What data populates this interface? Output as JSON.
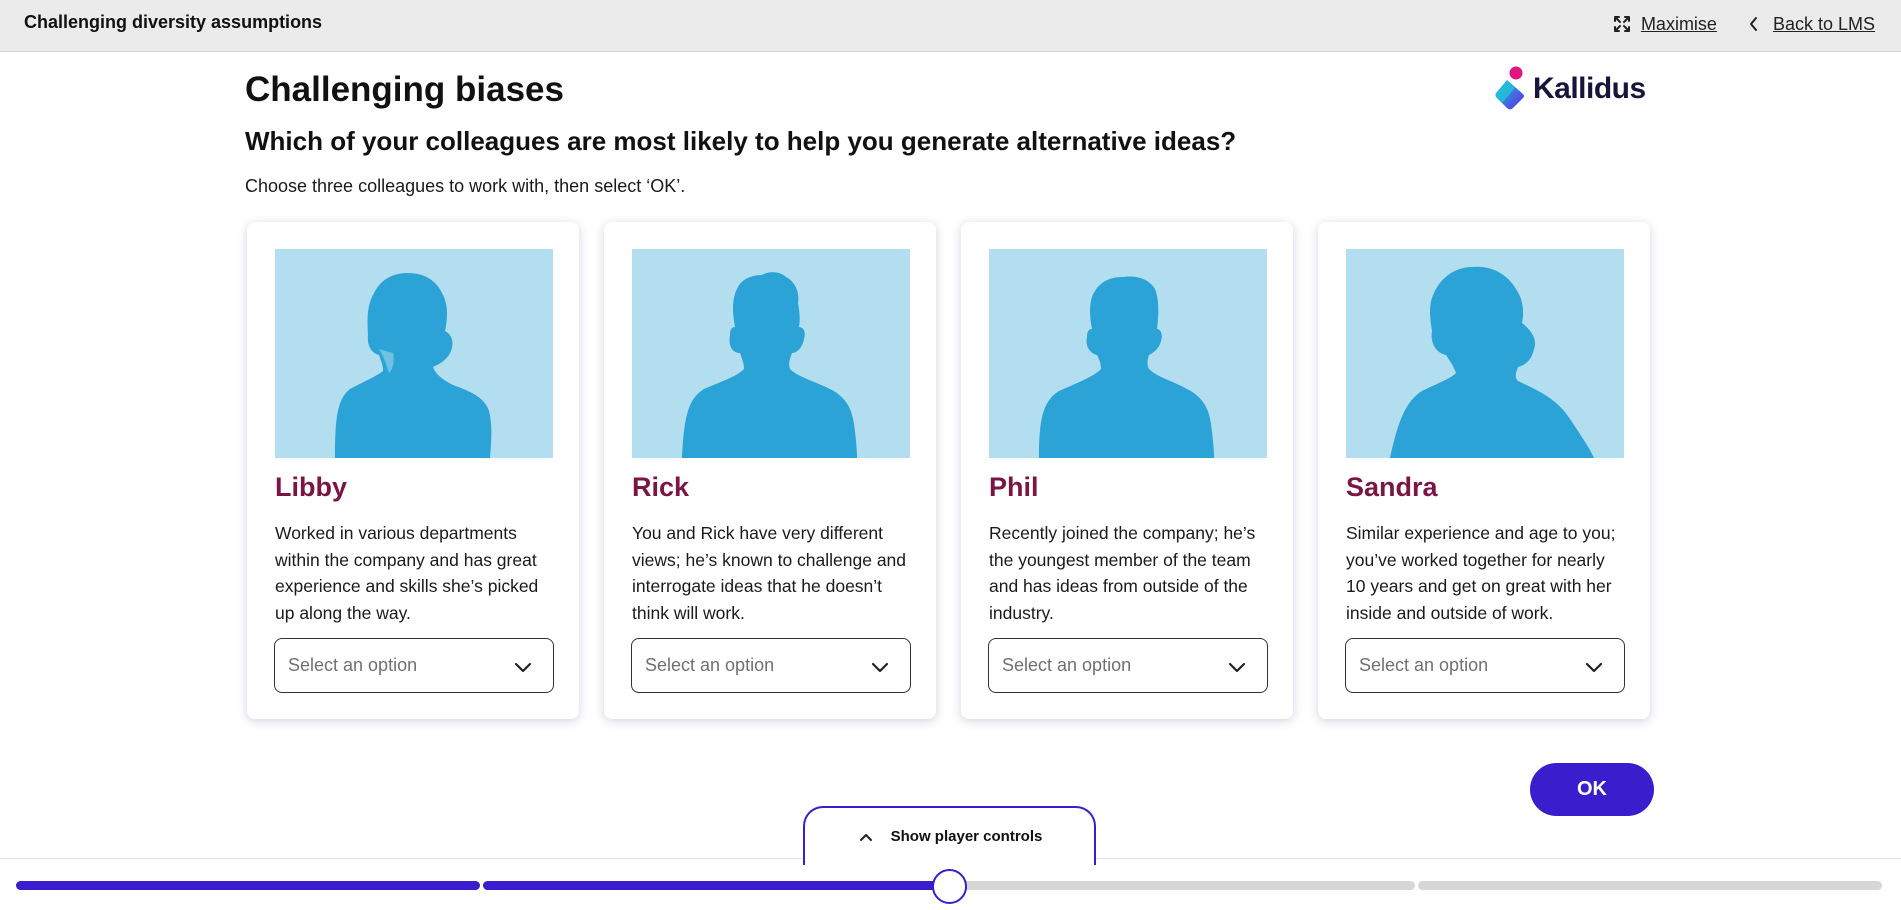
{
  "topbar": {
    "course_title": "Challenging diversity assumptions",
    "maximise_label": "Maximise",
    "back_label": "Back to LMS",
    "icons": [
      "expand-icon",
      "chevron-left-icon"
    ]
  },
  "logo": {
    "text": "Kallidus",
    "colors": [
      "#e0157f",
      "#5b2ee6",
      "#22c0d8"
    ]
  },
  "page_title": "Challenging biases",
  "question": "Which of your colleagues are most likely to help you generate alternative ideas?",
  "instruction": "Choose three colleagues to work with, then select ‘OK’.",
  "cards": [
    {
      "name": "Libby",
      "description": "Worked in various departments within the company and has great experience and skills she’s picked up along the way.",
      "select_value": "Select an option",
      "avatar": "female-silhouette"
    },
    {
      "name": "Rick",
      "description": "You and Rick have very different views; he’s known to challenge and interrogate ideas that he doesn’t think will work.",
      "select_value": "Select an option",
      "avatar": "male-silhouette"
    },
    {
      "name": "Phil",
      "description": "Recently joined the company; he’s the youngest member of the team and has ideas from outside of the industry.",
      "select_value": "Select an option",
      "avatar": "male-silhouette"
    },
    {
      "name": "Sandra",
      "description": "Similar experience and age to you; you’ve worked together for nearly 10 years and get on great with her inside and outside of work.",
      "select_value": "Select an option",
      "avatar": "female-silhouette"
    }
  ],
  "ok_label": "OK",
  "player_controls_label": "Show player controls",
  "progress": {
    "segment_fill_fractions": [
      1.0,
      1.0,
      0.0,
      0.0
    ],
    "current_position_fraction": 0.5,
    "colors": {
      "accent": "#3a1dcc",
      "track": "#d6d6d6"
    }
  },
  "colors": {
    "name_color": "#7a1645",
    "photo_bg": "#b3def0",
    "silhouette": "#2ba3d6"
  }
}
